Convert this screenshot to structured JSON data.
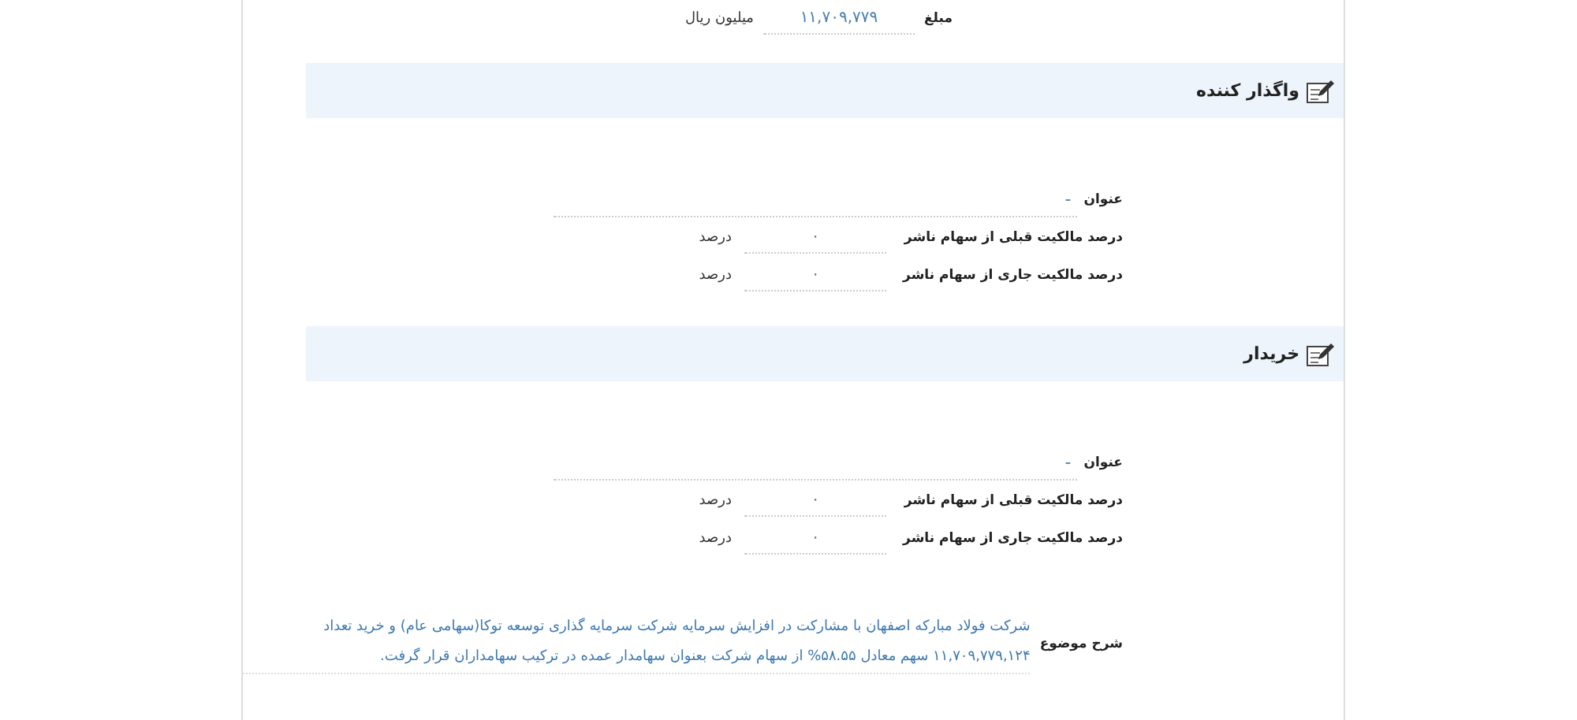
{
  "amount": {
    "label": "مبلغ",
    "value": "۱۱,۷۰۹,۷۷۹",
    "unit": "میلیون ریال"
  },
  "sections": [
    {
      "title": "واگذار کننده",
      "fields": [
        {
          "kind": "title",
          "label": "عنوان",
          "value": "-"
        },
        {
          "kind": "percent",
          "label": "درصد مالکیت قبلی از سهام ناشر",
          "value": "۰",
          "unit": "درصد"
        },
        {
          "kind": "percent",
          "label": "درصد مالکیت جاری از سهام ناشر",
          "value": "۰",
          "unit": "درصد"
        }
      ]
    },
    {
      "title": "خریدار",
      "fields": [
        {
          "kind": "title",
          "label": "عنوان",
          "value": "-"
        },
        {
          "kind": "percent",
          "label": "درصد مالکیت قبلی از سهام ناشر",
          "value": "۰",
          "unit": "درصد"
        },
        {
          "kind": "percent",
          "label": "درصد مالکیت جاری از سهام ناشر",
          "value": "۰",
          "unit": "درصد"
        }
      ]
    }
  ],
  "description": {
    "label": "شرح موضوع",
    "text": "شرکت فولاد مبارکه اصفهان با مشارکت در افزایش سرمایه شرکت سرمایه گذاری توسعه توکا(سهامی عام) و خرید تعداد ۱۱,۷۰۹,۷۷۹,۱۲۴ سهم معادل ۵۸.۵۵% از سهام شرکت بعنوان سهامدار عمده در ترکیب سهامداران قرار گرفت."
  }
}
